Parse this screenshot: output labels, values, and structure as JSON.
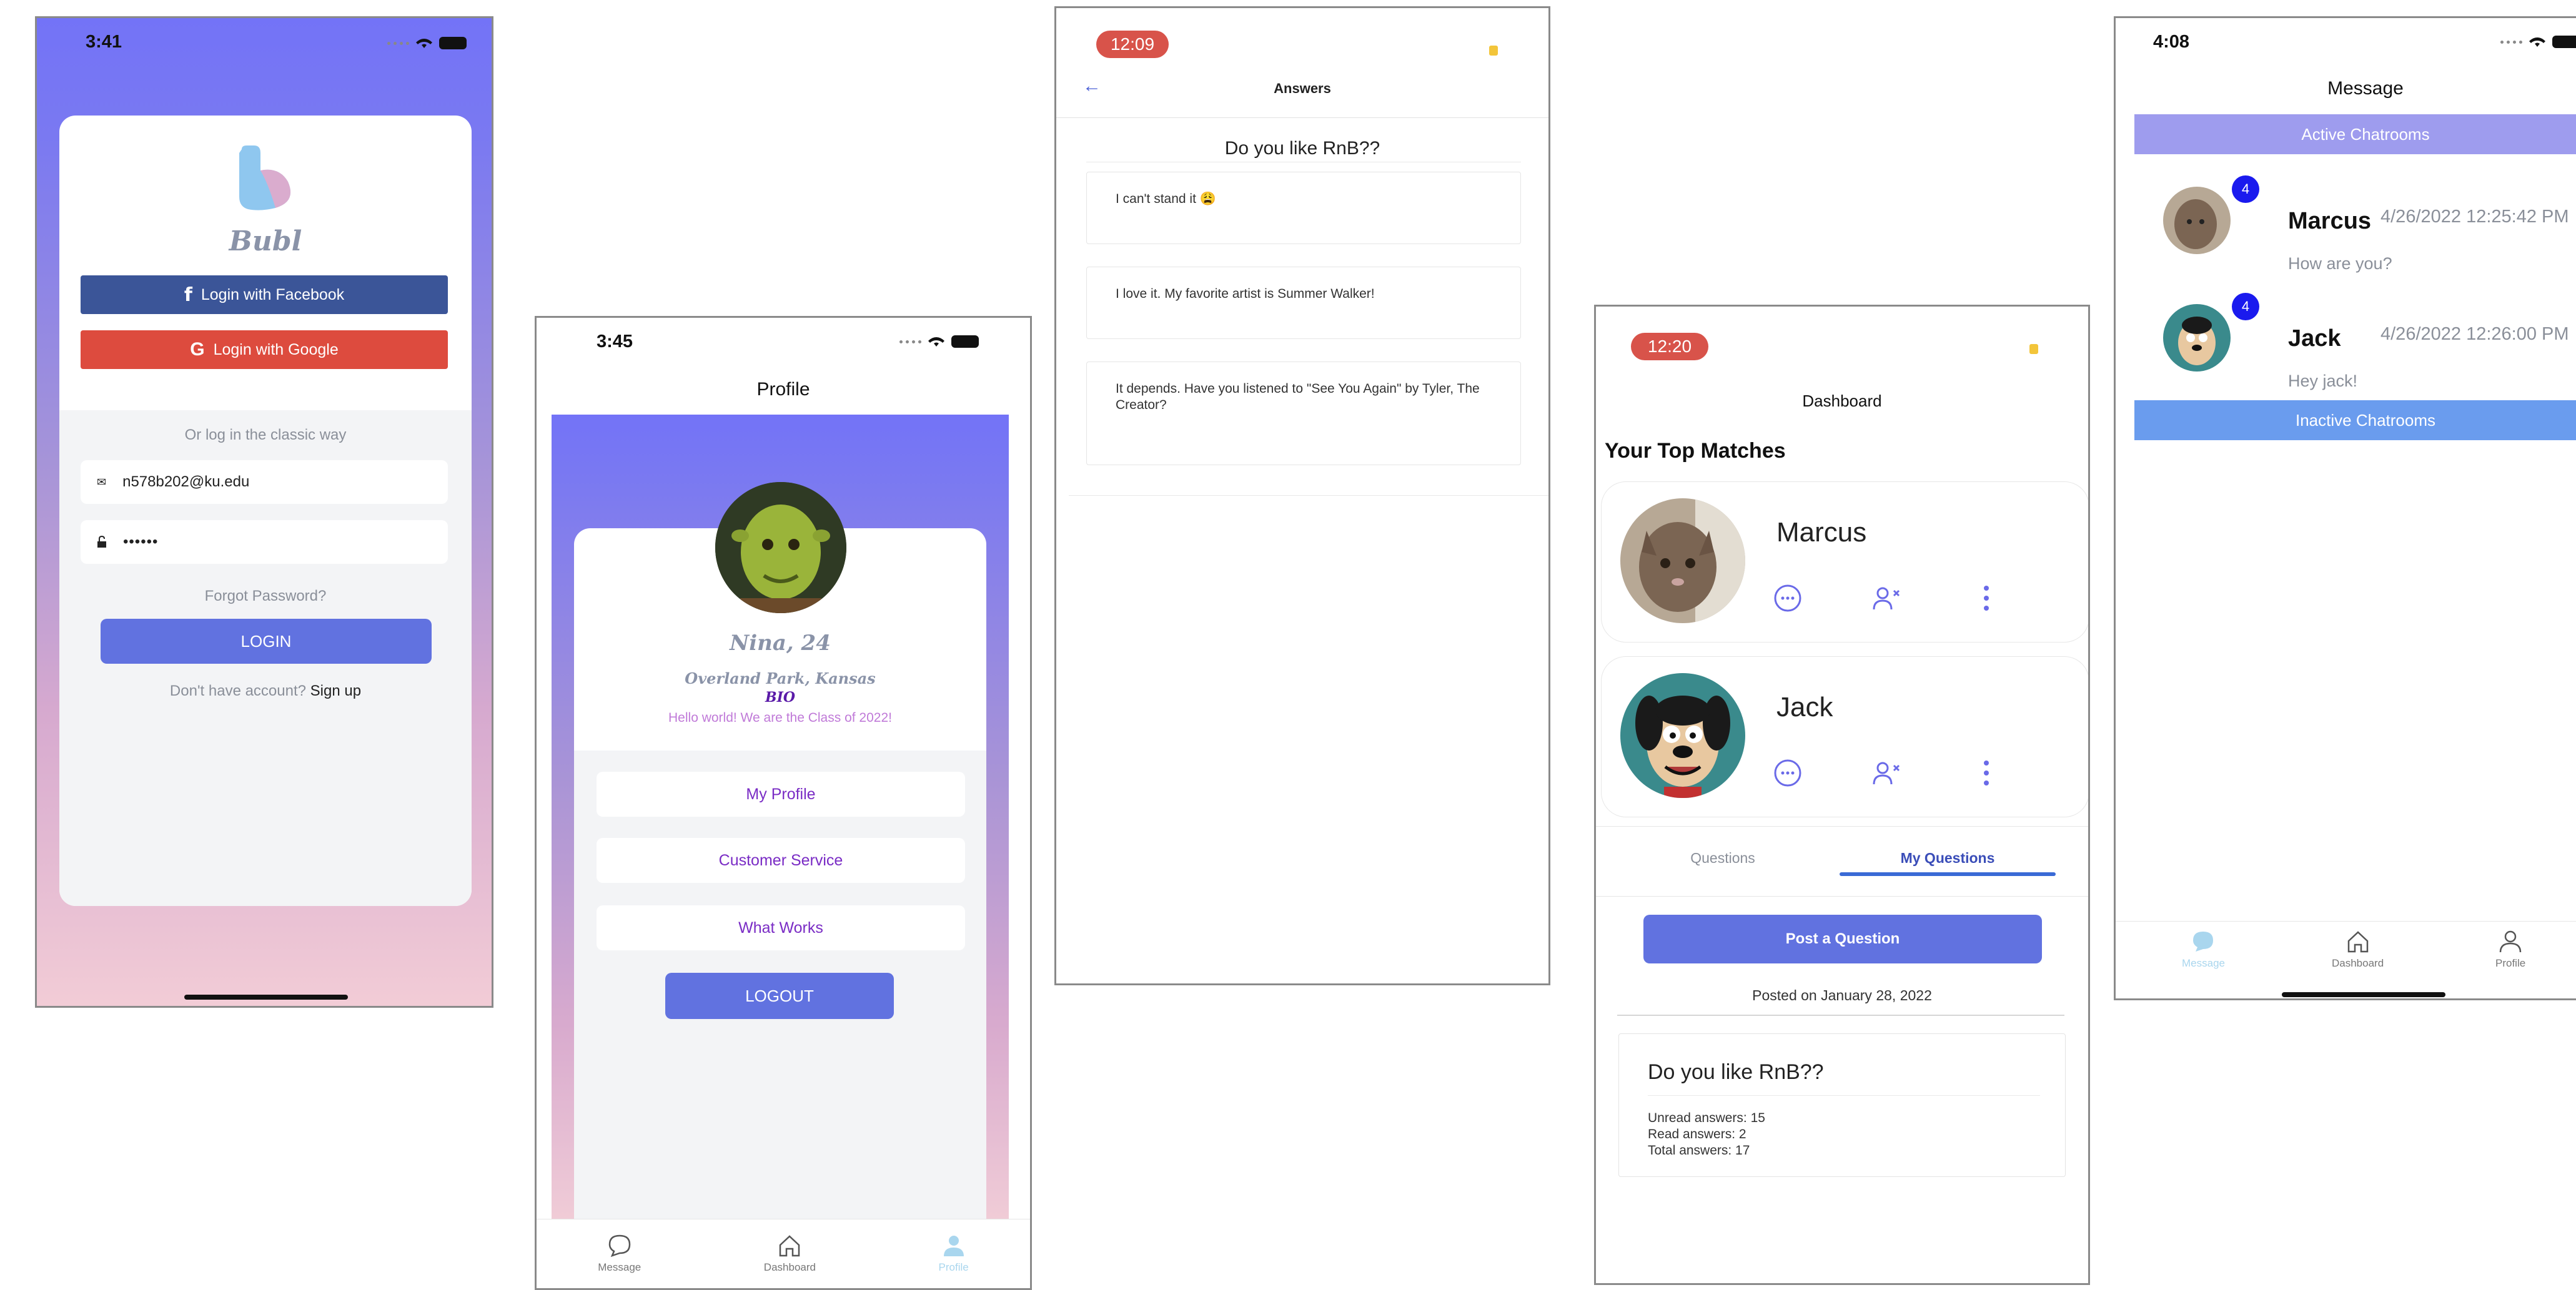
{
  "login": {
    "status_time": "3:41",
    "app_name": "Bubl",
    "facebook_label": "Login with Facebook",
    "google_label": "Login with Google",
    "classic_text": "Or log in the classic way",
    "email_value": "n578b202@ku.edu",
    "password_value": "••••••",
    "forgot_label": "Forgot Password?",
    "login_label": "LOGIN",
    "no_account_text": "Don't have account?",
    "signup_label": "Sign up",
    "colors": {
      "gradient_top": "#7373f7",
      "gradient_bottom": "#f2ccd6",
      "facebook": "#3b5598",
      "google": "#dd4b3e",
      "primary": "#6172e0"
    }
  },
  "profile": {
    "status_time": "3:45",
    "title": "Profile",
    "name_age": "Nina, 24",
    "location": "Overland Park, Kansas",
    "bio_label": "BIO",
    "bio_text": "Hello world! We are the Class of 2022!",
    "menu": [
      "My Profile",
      "Customer Service",
      "What Works"
    ],
    "logout_label": "LOGOUT",
    "tabs": [
      "Message",
      "Dashboard",
      "Profile"
    ],
    "active_tab": "Profile"
  },
  "answers": {
    "status_time": "12:09",
    "title": "Answers",
    "question": "Do you like RnB??",
    "items": [
      "I can't stand it 😩",
      "I love it. My favorite artist is Summer Walker!",
      "It depends. Have you listened to \"See You Again\" by Tyler, The Creator?"
    ]
  },
  "dashboard": {
    "status_time": "12:20",
    "title": "Dashboard",
    "top_matches_heading": "Your Top Matches",
    "matches": [
      {
        "name": "Marcus",
        "avatar": "cat-photo"
      },
      {
        "name": "Jack",
        "avatar": "cartoon-dog"
      }
    ],
    "tabs": [
      "Questions",
      "My Questions"
    ],
    "active_tab": "My Questions",
    "post_button": "Post a Question",
    "posted_on": "Posted on January 28, 2022",
    "question": "Do you like RnB??",
    "stats": [
      "Unread answers: 15",
      "Read answers: 2",
      "Total answers: 17"
    ]
  },
  "message": {
    "status_time": "4:08",
    "title": "Message",
    "active_label": "Active Chatrooms",
    "inactive_label": "Inactive Chatrooms",
    "chats": [
      {
        "name": "Marcus",
        "timestamp": "4/26/2022 12:25:42 PM",
        "preview": "How are you?",
        "unread": "4"
      },
      {
        "name": "Jack",
        "timestamp": "4/26/2022 12:26:00 PM",
        "preview": "Hey jack!",
        "unread": "4"
      }
    ],
    "tabs": [
      "Message",
      "Dashboard",
      "Profile"
    ],
    "active_tab": "Message"
  }
}
